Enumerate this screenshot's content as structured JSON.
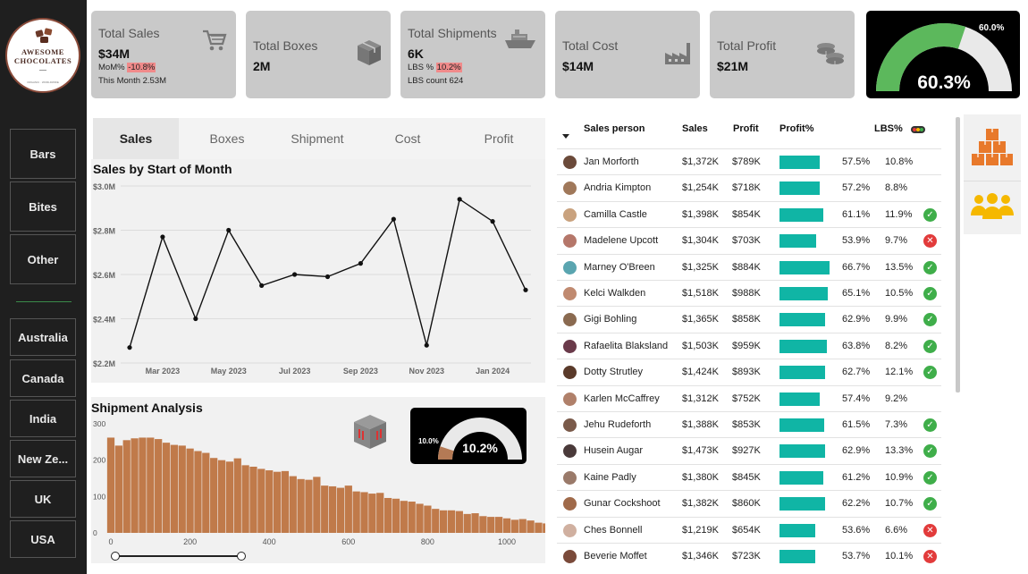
{
  "brand": {
    "line1": "AWESOME",
    "line2": "CHOCOLATES",
    "tagline": "ORGANIC · WORLDWIDE"
  },
  "nav_products": [
    "Bars",
    "Bites",
    "Other"
  ],
  "nav_regions": [
    "Australia",
    "Canada",
    "India",
    "New Ze...",
    "UK",
    "USA"
  ],
  "kpis": {
    "sales": {
      "label": "Total Sales",
      "value": "$34M",
      "mom_label": "MoM%",
      "mom_value": "-10.8%",
      "month_text": "This Month 2.53M"
    },
    "boxes": {
      "label": "Total Boxes",
      "value": "2M"
    },
    "shipments": {
      "label": "Total Shipments",
      "value": "6K",
      "lbs_label": "LBS %",
      "lbs_value": "10.2%",
      "lbs_count": "LBS count 624"
    },
    "cost": {
      "label": "Total Cost",
      "value": "$14M"
    },
    "profit": {
      "label": "Total Profit",
      "value": "$21M"
    }
  },
  "profit_gauge": {
    "target_label": "60.0%",
    "value_label": "60.3%",
    "fill": 0.603,
    "fill_color": "#5cb85c"
  },
  "tabs": [
    "Sales",
    "Boxes",
    "Shipment",
    "Cost",
    "Profit"
  ],
  "sales_chart": {
    "title": "Sales by Start of Month",
    "chart_data": {
      "type": "line",
      "title": "Sales by Start of Month",
      "x": [
        "Feb 2023",
        "Mar 2023",
        "Apr 2023",
        "May 2023",
        "Jun 2023",
        "Jul 2023",
        "Aug 2023",
        "Sep 2023",
        "Oct 2023",
        "Nov 2023",
        "Dec 2023",
        "Jan 2024",
        "Feb 2024"
      ],
      "xticks": [
        "Mar 2023",
        "May 2023",
        "Jul 2023",
        "Sep 2023",
        "Nov 2023",
        "Jan 2024"
      ],
      "values": [
        2.27,
        2.77,
        2.4,
        2.8,
        2.55,
        2.6,
        2.59,
        2.65,
        2.85,
        2.28,
        2.94,
        2.84,
        2.53
      ],
      "yticks": [
        "$2.2M",
        "$2.4M",
        "$2.6M",
        "$2.8M",
        "$3.0M"
      ],
      "ylim": [
        2.2,
        3.0
      ],
      "grid": true
    }
  },
  "shipment_chart": {
    "title": "Shipment Analysis",
    "chart_data": {
      "type": "bar",
      "title": "Shipment Analysis",
      "bin_width": 20,
      "values": [
        262,
        240,
        255,
        260,
        262,
        262,
        258,
        248,
        242,
        240,
        232,
        225,
        220,
        206,
        200,
        196,
        205,
        186,
        182,
        176,
        172,
        168,
        170,
        156,
        148,
        146,
        154,
        130,
        128,
        124,
        130,
        114,
        112,
        108,
        110,
        96,
        94,
        88,
        86,
        80,
        75,
        66,
        62,
        62,
        60,
        52,
        54,
        46,
        44,
        44,
        40,
        36,
        38,
        34,
        28,
        26,
        26,
        24,
        22,
        20,
        18,
        18,
        16,
        14,
        14,
        12,
        12,
        12,
        10,
        10,
        10,
        14
      ],
      "xticks": [
        "0",
        "200",
        "400",
        "600",
        "800",
        "1000"
      ],
      "xlim": [
        0,
        1070
      ],
      "yticks": [
        "0",
        "100",
        "200",
        "300"
      ],
      "ylim": [
        0,
        300
      ],
      "bar_color": "#c07a4a"
    }
  },
  "lbs_gauge": {
    "target_label": "10.0%",
    "value_label": "10.2%",
    "fill": 0.102,
    "fill_color": "#b47a55"
  },
  "sales_table": {
    "headers": {
      "person": "Sales person",
      "sales": "Sales",
      "profit": "Profit",
      "profit_pct": "Profit%",
      "lbs": "LBS%"
    },
    "rows": [
      {
        "name": "Jan Morforth",
        "sales": "$1,372K",
        "profit": "$789K",
        "pct": "57.5%",
        "pct_val": 57.5,
        "lbs": "10.8%",
        "status": "none",
        "avatar": "#6b4a3a"
      },
      {
        "name": "Andria Kimpton",
        "sales": "$1,254K",
        "profit": "$718K",
        "pct": "57.2%",
        "pct_val": 57.2,
        "lbs": "8.8%",
        "status": "none",
        "avatar": "#a0785a"
      },
      {
        "name": "Camilla Castle",
        "sales": "$1,398K",
        "profit": "$854K",
        "pct": "61.1%",
        "pct_val": 61.1,
        "lbs": "11.9%",
        "status": "ok",
        "avatar": "#c9a27e"
      },
      {
        "name": "Madelene Upcott",
        "sales": "$1,304K",
        "profit": "$703K",
        "pct": "53.9%",
        "pct_val": 53.9,
        "lbs": "9.7%",
        "status": "bad",
        "avatar": "#b5776a"
      },
      {
        "name": "Marney O'Breen",
        "sales": "$1,325K",
        "profit": "$884K",
        "pct": "66.7%",
        "pct_val": 66.7,
        "lbs": "13.5%",
        "status": "ok",
        "avatar": "#5aa5b0"
      },
      {
        "name": "Kelci Walkden",
        "sales": "$1,518K",
        "profit": "$988K",
        "pct": "65.1%",
        "pct_val": 65.1,
        "lbs": "10.5%",
        "status": "ok",
        "avatar": "#c08a70"
      },
      {
        "name": "Gigi Bohling",
        "sales": "$1,365K",
        "profit": "$858K",
        "pct": "62.9%",
        "pct_val": 62.9,
        "lbs": "9.9%",
        "status": "ok",
        "avatar": "#8a6a50"
      },
      {
        "name": "Rafaelita Blaksland",
        "sales": "$1,503K",
        "profit": "$959K",
        "pct": "63.8%",
        "pct_val": 63.8,
        "lbs": "8.2%",
        "status": "ok",
        "avatar": "#6a3a4a"
      },
      {
        "name": "Dotty Strutley",
        "sales": "$1,424K",
        "profit": "$893K",
        "pct": "62.7%",
        "pct_val": 62.7,
        "lbs": "12.1%",
        "status": "ok",
        "avatar": "#5a3a2a"
      },
      {
        "name": "Karlen McCaffrey",
        "sales": "$1,312K",
        "profit": "$752K",
        "pct": "57.4%",
        "pct_val": 57.4,
        "lbs": "9.2%",
        "status": "none",
        "avatar": "#b0806a"
      },
      {
        "name": "Jehu Rudeforth",
        "sales": "$1,388K",
        "profit": "$853K",
        "pct": "61.5%",
        "pct_val": 61.5,
        "lbs": "7.3%",
        "status": "ok",
        "avatar": "#7a5a4a"
      },
      {
        "name": "Husein Augar",
        "sales": "$1,473K",
        "profit": "$927K",
        "pct": "62.9%",
        "pct_val": 62.9,
        "lbs": "13.3%",
        "status": "ok",
        "avatar": "#4a3a3a"
      },
      {
        "name": "Kaine Padly",
        "sales": "$1,380K",
        "profit": "$845K",
        "pct": "61.2%",
        "pct_val": 61.2,
        "lbs": "10.9%",
        "status": "ok",
        "avatar": "#9a7a6a"
      },
      {
        "name": "Gunar Cockshoot",
        "sales": "$1,382K",
        "profit": "$860K",
        "pct": "62.2%",
        "pct_val": 62.2,
        "lbs": "10.7%",
        "status": "ok",
        "avatar": "#a06a4a"
      },
      {
        "name": "Ches Bonnell",
        "sales": "$1,219K",
        "profit": "$654K",
        "pct": "53.6%",
        "pct_val": 53.6,
        "lbs": "6.6%",
        "status": "bad",
        "avatar": "#d0b0a0"
      },
      {
        "name": "Beverie Moffet",
        "sales": "$1,346K",
        "profit": "$723K",
        "pct": "53.7%",
        "pct_val": 53.7,
        "lbs": "10.1%",
        "status": "bad",
        "avatar": "#7a4a3a"
      }
    ]
  },
  "colors": {
    "accent_teal": "#10b5a5",
    "accent_orange": "#e8792b",
    "icon_yellow": "#f5b800",
    "ok": "#3fae4a",
    "bad": "#e23b3b"
  }
}
